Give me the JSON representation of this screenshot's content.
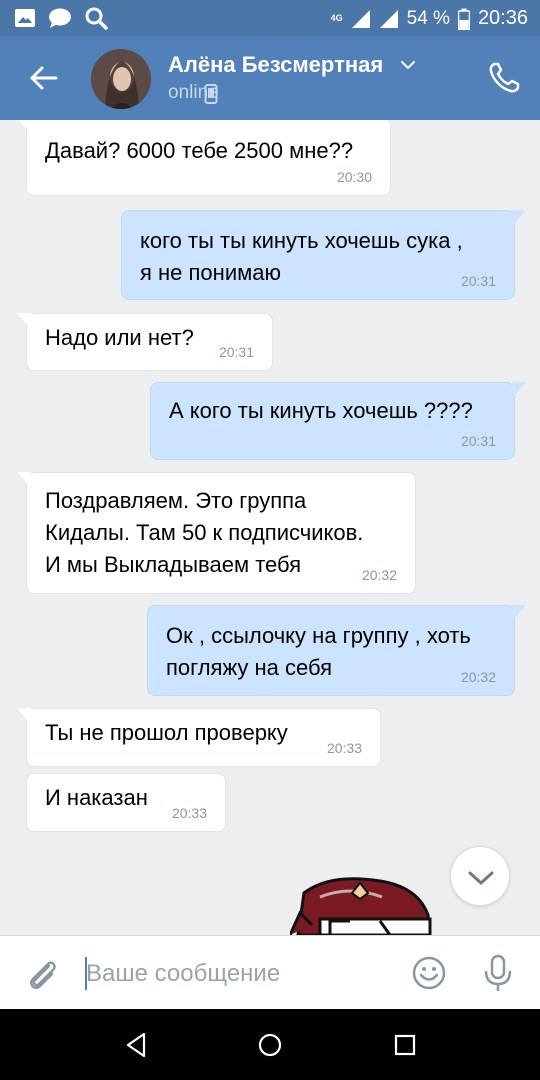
{
  "status_bar": {
    "network": "4G",
    "battery": "54 %",
    "time": "20:36"
  },
  "header": {
    "name": "Алёна Безсмертная",
    "status": "online"
  },
  "messages": [
    {
      "direction": "in",
      "text": "Давай? 6000 тебе 2500 мне??",
      "time": "20:30"
    },
    {
      "direction": "out",
      "text": "кого ты ты кинуть хочешь сука ,\nя не понимаю",
      "time": "20:31"
    },
    {
      "direction": "in",
      "text": "Надо или нет?",
      "time": "20:31"
    },
    {
      "direction": "out",
      "text": "А кого ты кинуть хочешь ????",
      "time": "20:31"
    },
    {
      "direction": "in",
      "text": "Поздравляем. Это группа\nКидалы. Там 50 к подписчиков.\nИ мы Выкладываем тебя",
      "time": "20:32"
    },
    {
      "direction": "out",
      "text": "Ок , ссылочку на группу , хоть\nпогляжу на себя",
      "time": "20:32"
    },
    {
      "direction": "in",
      "text": "Ты не прошол проверку",
      "time": "20:33"
    },
    {
      "direction": "in",
      "text": "И наказан",
      "time": "20:33"
    }
  ],
  "composer": {
    "placeholder": "Ваше сообщение"
  },
  "colors": {
    "status_bar": "#4a76a8",
    "header": "#5181b8",
    "outgoing_bubble": "#cce4ff",
    "incoming_bubble": "#ffffff",
    "background": "#edeef0"
  },
  "icons": [
    "gallery-icon",
    "chat-icon",
    "search-icon",
    "signal-icon",
    "battery-icon",
    "back-arrow-icon",
    "chevron-down-icon",
    "mobile-phone-icon",
    "phone-call-icon",
    "attach-icon",
    "emoji-icon",
    "microphone-icon",
    "nav-back-icon",
    "nav-home-icon",
    "nav-recent-icon"
  ]
}
